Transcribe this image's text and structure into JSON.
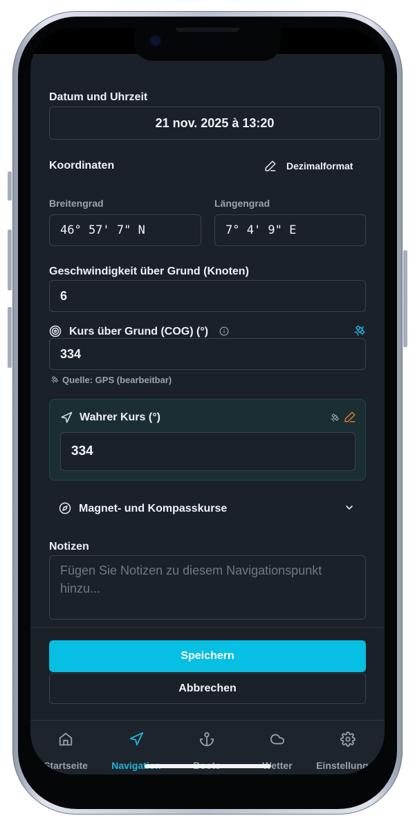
{
  "form": {
    "datetime_label": "Datum und Uhrzeit",
    "datetime_value": "21 nov. 2025 à 13:20",
    "coords_label": "Koordinaten",
    "format_toggle_label": "Dezimalformat",
    "lat_label": "Breitengrad",
    "lat_value": "46° 57' 7\" N",
    "lon_label": "Längengrad",
    "lon_value": "7° 4' 9\" E",
    "sog_label": "Geschwindigkeit über Grund (Knoten)",
    "sog_value": "6",
    "cog_label": "Kurs über Grund (COG) (°)",
    "cog_value": "334",
    "cog_source": "Quelle: GPS (bearbeitbar)",
    "true_course_label": "Wahrer Kurs (°)",
    "true_course_value": "334",
    "magnetic_label": "Magnet- und Kompasskurse",
    "notes_label": "Notizen",
    "notes_placeholder": "Fügen Sie Notizen zu diesem Navigationspunkt hinzu..."
  },
  "actions": {
    "save_label": "Speichern",
    "cancel_label": "Abbrechen"
  },
  "tabs": [
    {
      "label": "Startseite",
      "icon": "home-icon"
    },
    {
      "label": "Navigation",
      "icon": "navigation-icon"
    },
    {
      "label": "Boote",
      "icon": "anchor-icon"
    },
    {
      "label": "Wetter",
      "icon": "cloud-icon"
    },
    {
      "label": "Einstellungen",
      "icon": "gear-icon"
    }
  ],
  "colors": {
    "background": "#1b2129",
    "accent": "#06bfe2",
    "card_highlight": "#1b2e33",
    "edit_icon": "#e07b2c"
  }
}
